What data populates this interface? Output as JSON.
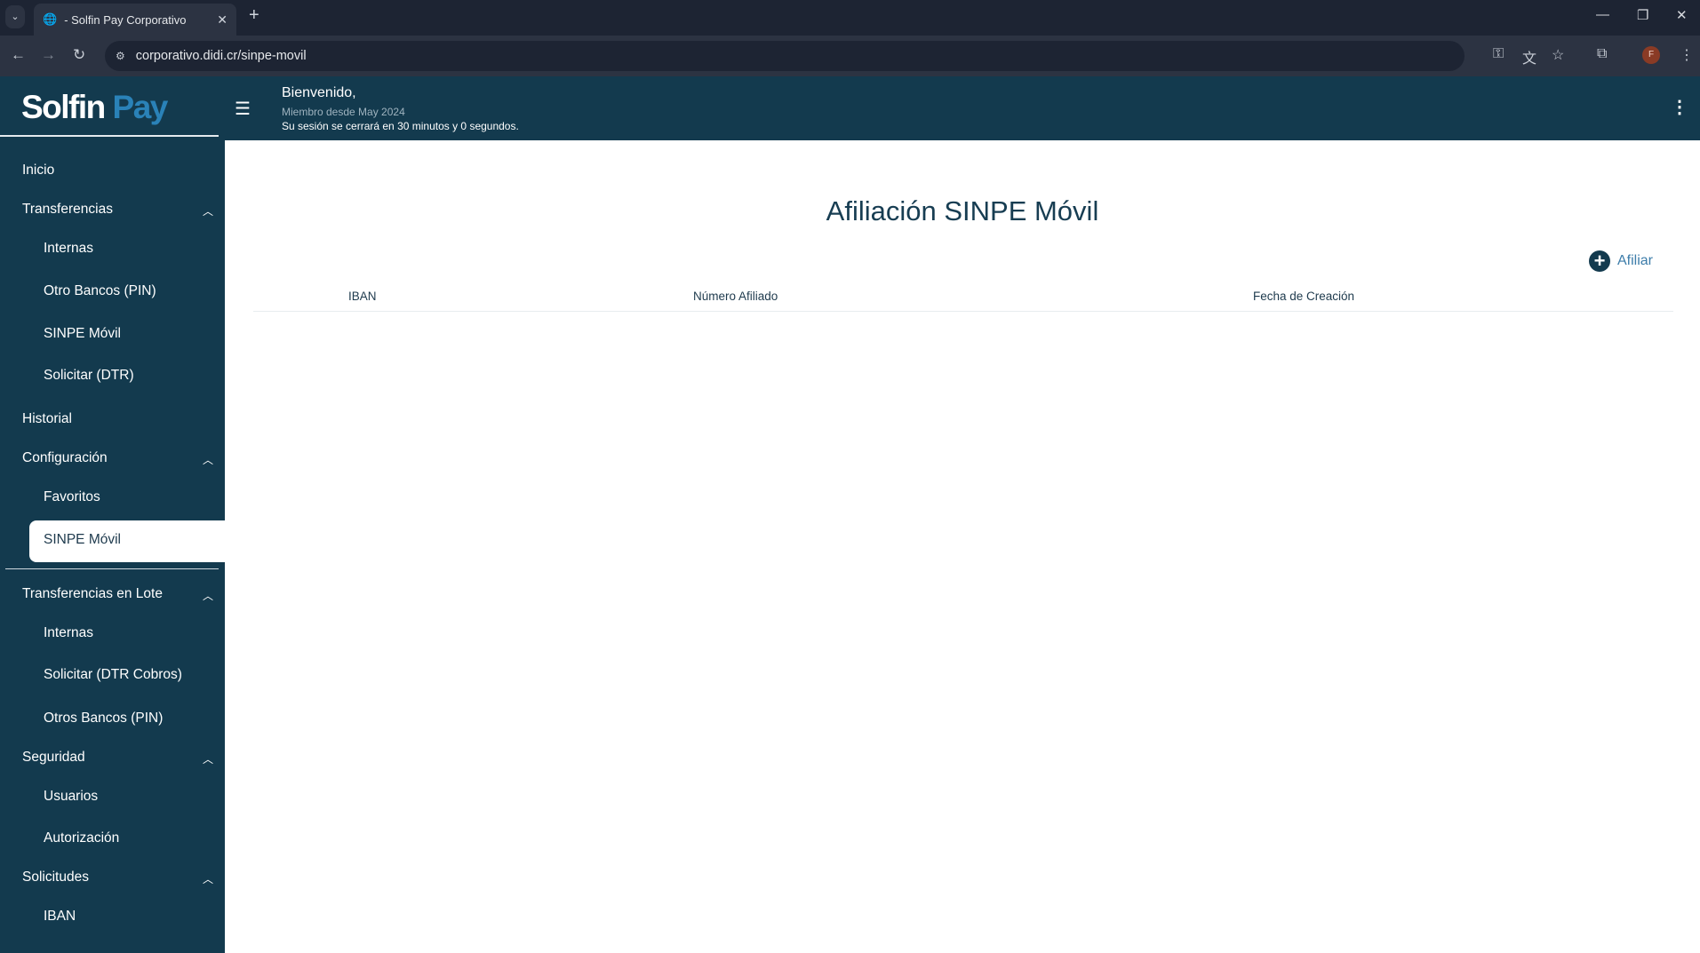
{
  "browser": {
    "tab_title": "- Solfin Pay Corporativo",
    "url": "corporativo.didi.cr/sinpe-movil",
    "profile_initial": "F"
  },
  "header": {
    "logo_part1": "Solfin",
    "logo_part2": "Pay",
    "welcome": "Bienvenido,",
    "member_since": "Miembro desde May 2024",
    "session": "Su sesión se cerrará en 30 minutos y 0 segundos."
  },
  "sidebar": {
    "inicio": "Inicio",
    "transferencias": "Transferencias",
    "t_internas": "Internas",
    "t_otros": "Otro Bancos (PIN)",
    "t_sinpe": "SINPE Móvil",
    "t_dtr": "Solicitar (DTR)",
    "historial": "Historial",
    "configuracion": "Configuración",
    "c_favoritos": "Favoritos",
    "c_sinpe": "SINPE Móvil",
    "lote": "Transferencias en Lote",
    "l_internas": "Internas",
    "l_dtr": "Solicitar (DTR Cobros)",
    "l_otros": "Otros Bancos (PIN)",
    "seguridad": "Seguridad",
    "s_usuarios": "Usuarios",
    "s_autorizacion": "Autorización",
    "solicitudes": "Solicitudes",
    "so_iban": "IBAN"
  },
  "main": {
    "title": "Afiliación SINPE Móvil",
    "afiliar": "Afiliar",
    "columns": [
      "IBAN",
      "Número Afiliado",
      "Fecha de Creación"
    ]
  },
  "colors": {
    "primary": "#133a4e",
    "accent": "#2a82b8"
  }
}
